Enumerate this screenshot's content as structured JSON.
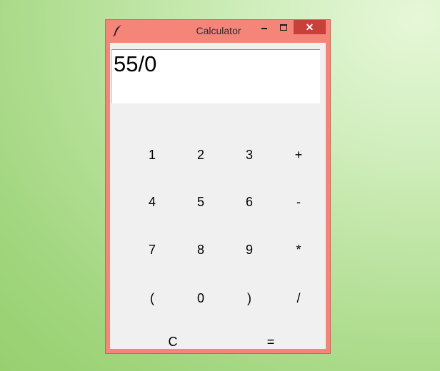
{
  "window": {
    "title": "Calculator",
    "close_label": "✕"
  },
  "display": {
    "value": "55/0"
  },
  "keypad": {
    "rows": [
      [
        "1",
        "2",
        "3",
        "+"
      ],
      [
        "4",
        "5",
        "6",
        "-"
      ],
      [
        "7",
        "8",
        "9",
        "*"
      ],
      [
        "(",
        "0",
        ")",
        "/"
      ]
    ],
    "clear": "C",
    "equals": "="
  },
  "colors": {
    "titlebar": "#f68579",
    "close_button": "#c7403a",
    "client_background": "#f0f0f0",
    "display_background": "#ffffff"
  },
  "icons": {
    "app": "feather-icon",
    "minimize": "minimize-icon",
    "maximize": "maximize-icon",
    "close": "close-icon"
  }
}
